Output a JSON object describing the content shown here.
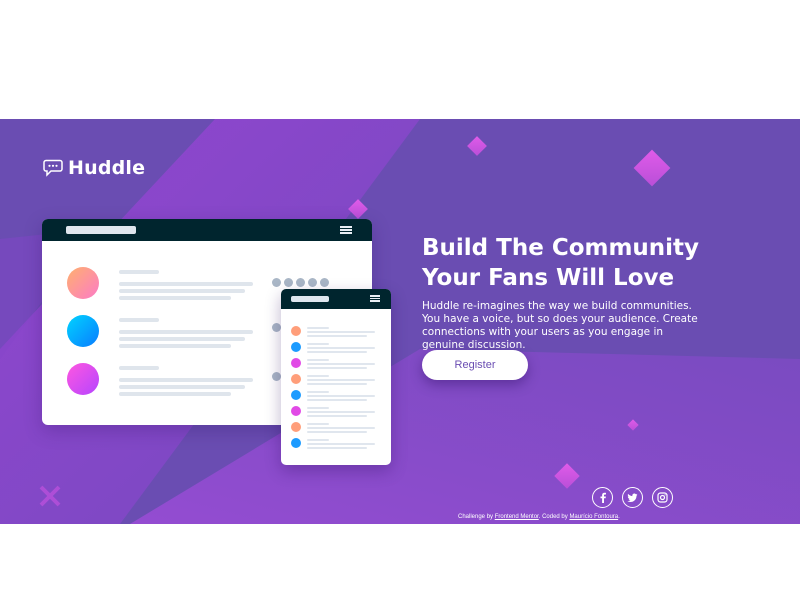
{
  "brand": {
    "name": "Huddle",
    "icon": "chat-bubble-icon"
  },
  "hero": {
    "title_line1": "Build The Community",
    "title_line2": "Your Fans Will Love",
    "description": "Huddle re-imagines the way we build communities. You have a voice, but so does your audience. Create connections with your users as you engage in genuine discussion.",
    "cta_label": "Register"
  },
  "mockup": {
    "avatar_gradients": [
      [
        "#ffb06e",
        "#fc7bc7"
      ],
      [
        "#00d4ff",
        "#0a7cff"
      ],
      [
        "#ff57e0",
        "#b545ff"
      ]
    ],
    "mini_avatar_colors": [
      "#ff9e7a",
      "#1c9bff",
      "#e14ae6",
      "#ff9e7a",
      "#1c9bff",
      "#e14ae6",
      "#ff9e7a",
      "#1c9bff"
    ]
  },
  "social": [
    {
      "name": "facebook-icon"
    },
    {
      "name": "twitter-icon"
    },
    {
      "name": "instagram-icon"
    }
  ],
  "footer": {
    "challenge_prefix": "Challenge by",
    "challenge_link": "Frontend Mentor",
    "coded_prefix": "Coded by",
    "coded_link": "Maurício Fontoura"
  },
  "colors": {
    "background": "#6a4db2",
    "accent": "#c84fd6",
    "dark_bar": "#00252e",
    "text": "#ffffff"
  }
}
